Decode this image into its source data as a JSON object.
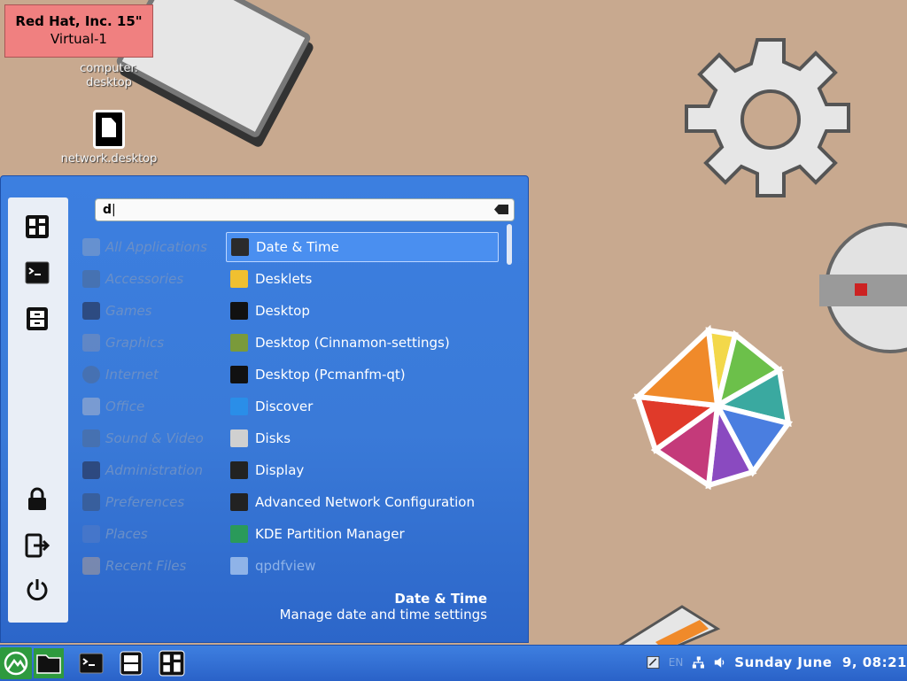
{
  "vm_label": {
    "line1": "Red Hat, Inc. 15\"",
    "line2": "Virtual-1"
  },
  "desktop_icons": [
    {
      "name": "computer.desktop",
      "label_line1": "computer.",
      "label_line2": "desktop"
    },
    {
      "name": "network.desktop",
      "label": "network.desktop"
    }
  ],
  "search": {
    "value": "d"
  },
  "categories": [
    "All Applications",
    "Accessories",
    "Games",
    "Graphics",
    "Internet",
    "Office",
    "Sound & Video",
    "Administration",
    "Preferences",
    "Places",
    "Recent Files"
  ],
  "apps": [
    {
      "label": "Date & Time",
      "icon": "datetime-icon",
      "color": "#2b2b2b",
      "selected": true
    },
    {
      "label": "Desklets",
      "icon": "desklets-icon",
      "color": "#f0c030"
    },
    {
      "label": "Desktop",
      "icon": "folder-icon",
      "color": "#111111"
    },
    {
      "label": "Desktop (Cinnamon-settings)",
      "icon": "desktop-settings-icon",
      "color": "#7a9a3a"
    },
    {
      "label": "Desktop (Pcmanfm-qt)",
      "icon": "folder-icon",
      "color": "#111111"
    },
    {
      "label": "Discover",
      "icon": "discover-icon",
      "color": "#2a8ee8"
    },
    {
      "label": "Disks",
      "icon": "disks-icon",
      "color": "#d0d0d0"
    },
    {
      "label": "Display",
      "icon": "display-icon",
      "color": "#222222"
    },
    {
      "label": "Advanced Network Configuration",
      "icon": "network-config-icon",
      "color": "#222222"
    },
    {
      "label": "KDE Partition Manager",
      "icon": "partition-manager-icon",
      "color": "#2a9a5a"
    },
    {
      "label": "qpdfview",
      "icon": "qpdfview-icon",
      "color": "#8fb3e8",
      "faded": true
    }
  ],
  "description": {
    "title": "Date & Time",
    "text": "Manage date and time settings"
  },
  "tray": {
    "keyboard_layout": "EN",
    "clock": "Sunday June  9, 08:21"
  },
  "colors": {
    "desktop_bg": "#c8a98f",
    "menu_bg": "#3c7fe0",
    "selected_bg": "#4a8ff0"
  }
}
